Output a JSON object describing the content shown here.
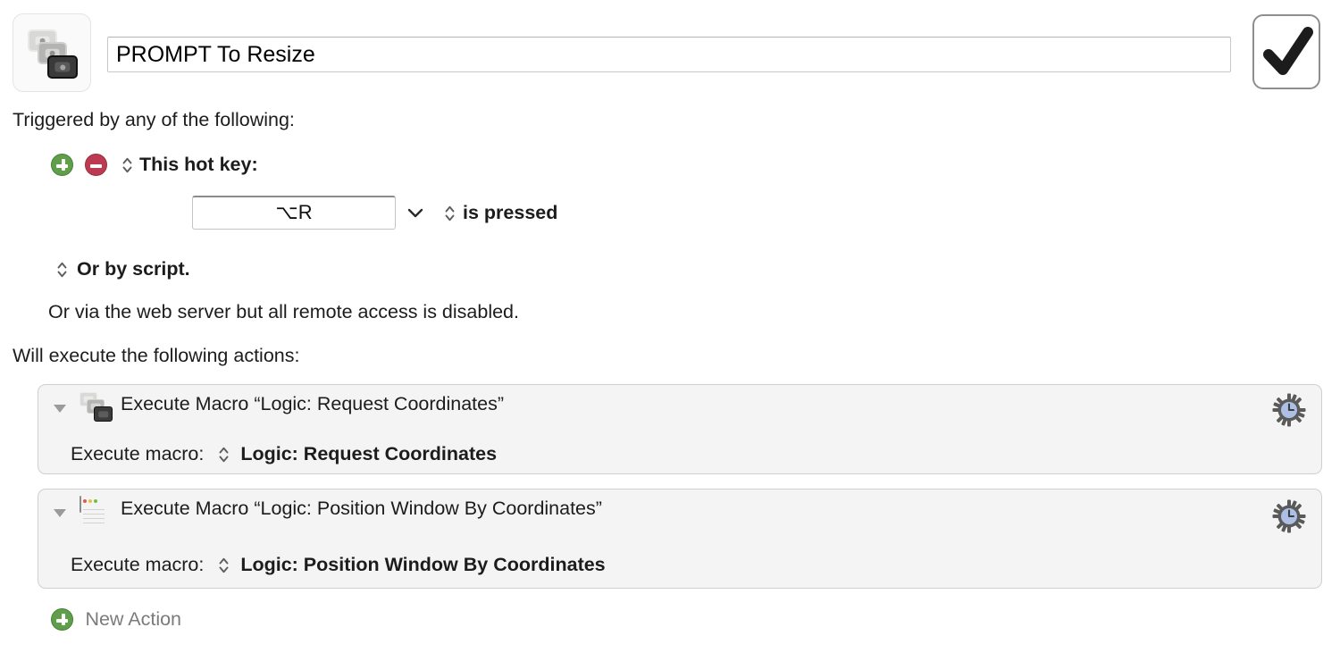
{
  "header": {
    "macro_icon_name": "macro-stack-icon",
    "title_value": "PROMPT To Resize",
    "title_placeholder": "Macro Name",
    "confirm_icon": "checkmark-icon"
  },
  "triggers": {
    "section_label": "Triggered by any of the following:",
    "add_button_label": "+",
    "remove_button_label": "−",
    "hotkey_label": "This hot key:",
    "hotkey_value": "⌥R",
    "hotkey_condition": "is pressed",
    "or_by_script_label": "Or by script.",
    "web_server_note": "Or via the web server but all remote access is disabled."
  },
  "actions": {
    "section_label": "Will execute the following actions:",
    "items": [
      {
        "title": "Execute Macro “Logic: Request Coordinates”",
        "field_label": "Execute macro:",
        "field_value": "Logic: Request Coordinates",
        "icon": "macro-stack-icon",
        "gear_icon": "gear-clock-icon",
        "disclosure": "expanded"
      },
      {
        "title": "Execute Macro “Logic: Position Window By Coordinates”",
        "field_label": "Execute macro:",
        "field_value": "Logic: Position Window By Coordinates",
        "icon": "window-icon",
        "gear_icon": "gear-clock-icon",
        "disclosure": "expanded"
      }
    ],
    "new_action_label": "New Action"
  },
  "colors": {
    "add_green": "#5f9f4a",
    "remove_red": "#bc3b52",
    "row_background": "#f4f4f4",
    "row_border": "#cfcfcf",
    "gear_face": "#aebfe6",
    "gear_body": "#5a5a5a",
    "muted_text": "#7b7b7b"
  }
}
